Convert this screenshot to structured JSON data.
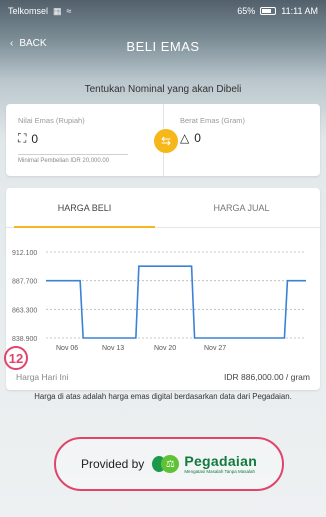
{
  "status_bar": {
    "carrier": "Telkomsel",
    "battery": "65%",
    "time": "11:11 AM"
  },
  "header": {
    "back_label": "BACK",
    "title": "BELI EMAS"
  },
  "nominal": {
    "subtitle": "Tentukan Nominal yang akan Dibeli",
    "left_label": "Nilai Emas (Rupiah)",
    "left_value": "0",
    "min_text": "Minimal Pembelian IDR 20,000.00",
    "right_label": "Berat Emas (Gram)",
    "right_value": "0"
  },
  "tabs": {
    "buy": "HARGA BELI",
    "sell": "HARGA JUAL"
  },
  "chart_data": {
    "type": "line",
    "x": [
      "Nov 06",
      "Nov 13",
      "Nov 20",
      "Nov 27"
    ],
    "y_ticks": [
      "912.100",
      "887.700",
      "863.300",
      "838.900"
    ],
    "ylim": [
      838900,
      912100
    ],
    "series": [
      {
        "values": [
          887700,
          887700,
          838900,
          838900,
          838900,
          900000,
          900000,
          900000,
          838900,
          838900,
          838900,
          838900,
          838900,
          887700,
          887700
        ]
      }
    ],
    "color": "#3b82d6"
  },
  "price_footer": {
    "label": "Harga Hari Ini",
    "value": "IDR 886,000.00 / gram"
  },
  "badge": "12",
  "disclaimer": "Harga di atas adalah harga emas digital berdasarkan data dari Pegadaian.",
  "provider": {
    "provided_by": "Provided by",
    "brand": "Pegadaian",
    "tagline": "Mengatasi Masalah Tanpa Masalah"
  }
}
